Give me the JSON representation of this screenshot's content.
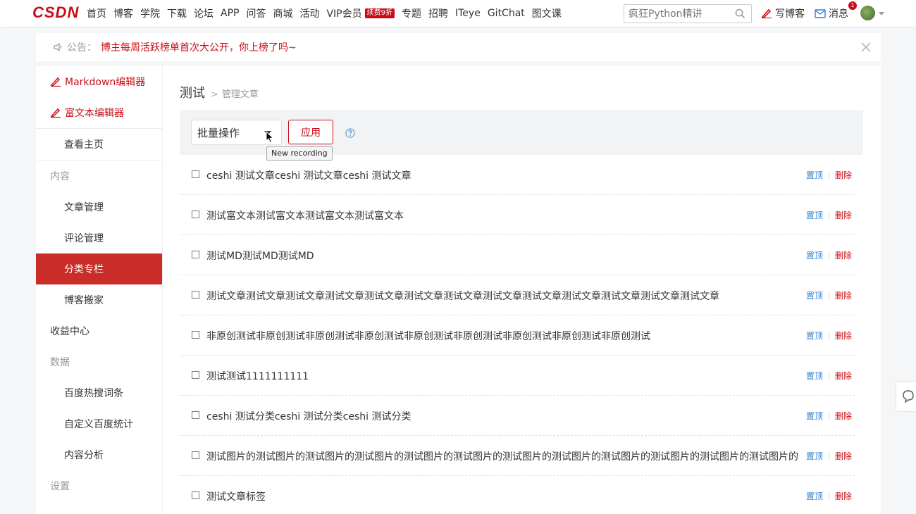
{
  "header": {
    "logo": "CSDN",
    "nav": [
      "首页",
      "博客",
      "学院",
      "下载",
      "论坛",
      "APP",
      "问答",
      "商城",
      "活动",
      "VIP会员",
      "专题",
      "招聘",
      "ITeye",
      "GitChat",
      "图文课"
    ],
    "vip_badge": "续费9折",
    "search_placeholder": "疯狂Python精讲",
    "write_blog": "写博客",
    "messages": "消息",
    "message_count": "1"
  },
  "notice": {
    "label": "公告：",
    "text": "博主每周活跃榜单首次大公开，你上榜了吗~"
  },
  "sidebar": {
    "markdown_editor": "Markdown编辑器",
    "richtext_editor": "富文本编辑器",
    "view_home": "查看主页",
    "group_content": "内容",
    "article_manage": "文章管理",
    "comment_manage": "评论管理",
    "category_column": "分类专栏",
    "blog_move": "博客搬家",
    "revenue_center": "收益中心",
    "group_data": "数据",
    "baidu_hot": "百度热搜词条",
    "custom_baidu": "自定义百度统计",
    "content_analysis": "内容分析",
    "group_settings": "设置"
  },
  "main": {
    "title": "测试",
    "breadcrumb_sep": ">",
    "breadcrumb_sub": "管理文章",
    "bulk_select": "批量操作",
    "apply_label": "应用",
    "tooltip": "New recording",
    "action_top": "置顶",
    "action_delete": "删除",
    "rows": [
      "ceshi 测试文章ceshi 测试文章ceshi 测试文章",
      "测试富文本测试富文本测试富文本测试富文本",
      "测试MD测试MD测试MD",
      "测试文章测试文章测试文章测试文章测试文章测试文章测试文章测试文章测试文章测试文章测试文章测试文章测试文章",
      "非原创测试非原创测试非原创测试非原创测试非原创测试非原创测试非原创测试非原创测试非原创测试",
      "测试测试1111111111",
      "ceshi 测试分类ceshi 测试分类ceshi 测试分类",
      "测试图片的测试图片的测试图片的测试图片的测试图片的测试图片的测试图片的测试图片的测试图片的测试图片的测试图片的测试图片的",
      "测试文章标签"
    ]
  },
  "colors": {
    "brand_red": "#ca0c16",
    "active_bg": "#ca2d27",
    "link_blue": "#2e80d1"
  }
}
